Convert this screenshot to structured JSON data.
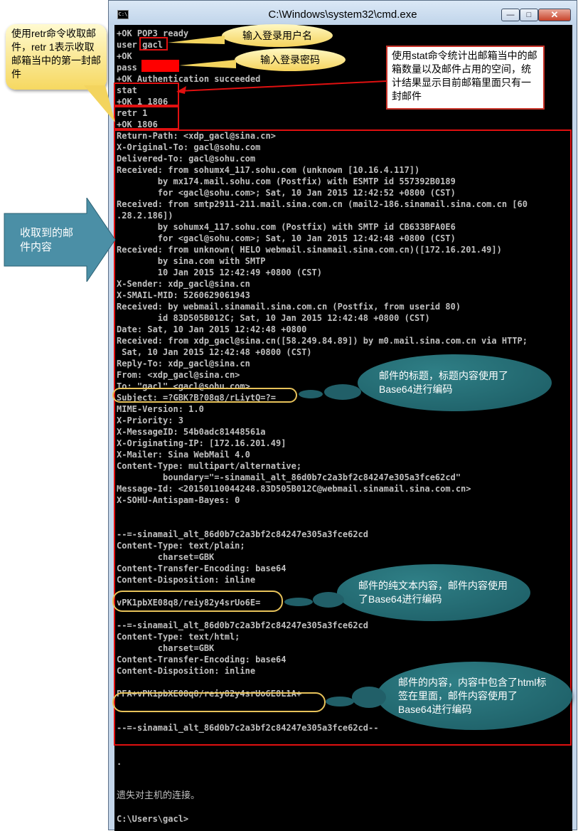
{
  "window": {
    "title": "C:\\Windows\\system32\\cmd.exe",
    "icon_text": "C:\\",
    "min": "—",
    "max": "□",
    "close": "✕"
  },
  "console_lines": [
    "+OK POP3 ready",
    "user gacl",
    "+OK",
    "pass",
    "+OK Authentication succeeded",
    "stat",
    "+OK 1 1806",
    "retr 1",
    "+OK 1806",
    "Return-Path: <xdp_gacl@sina.cn>",
    "X-Original-To: gacl@sohu.com",
    "Delivered-To: gacl@sohu.com",
    "Received: from sohumx4_117.sohu.com (unknown [10.16.4.117])",
    "        by mx174.mail.sohu.com (Postfix) with ESMTP id 557392B0189",
    "        for <gacl@sohu.com>; Sat, 10 Jan 2015 12:42:52 +0800 (CST)",
    "Received: from smtp2911-211.mail.sina.com.cn (mail2-186.sinamail.sina.com.cn [60",
    ".28.2.186])",
    "        by sohumx4_117.sohu.com (Postfix) with SMTP id CB633BFA0E6",
    "        for <gacl@sohu.com>; Sat, 10 Jan 2015 12:42:48 +0800 (CST)",
    "Received: from unknown( HELO webmail.sinamail.sina.com.cn)([172.16.201.49])",
    "        by sina.com with SMTP",
    "        10 Jan 2015 12:42:49 +0800 (CST)",
    "X-Sender: xdp_gacl@sina.cn",
    "X-SMAIL-MID: 5260629061943",
    "Received: by webmail.sinamail.sina.com.cn (Postfix, from userid 80)",
    "        id 83D505B012C; Sat, 10 Jan 2015 12:42:48 +0800 (CST)",
    "Date: Sat, 10 Jan 2015 12:42:48 +0800",
    "Received: from xdp_gacl@sina.cn([58.249.84.89]) by m0.mail.sina.com.cn via HTTP;",
    " Sat, 10 Jan 2015 12:42:48 +0800 (CST)",
    "Reply-To: xdp_gacl@sina.cn",
    "From: <xdp_gacl@sina.cn>",
    "To: \"gacl\" <gacl@sohu.com>",
    "Subject: =?GBK?B?08q8/rLiytQ=?=",
    "MIME-Version: 1.0",
    "X-Priority: 3",
    "X-MessageID: 54b0adc81448561a",
    "X-Originating-IP: [172.16.201.49]",
    "X-Mailer: Sina WebMail 4.0",
    "Content-Type: multipart/alternative;",
    "         boundary=\"=-sinamail_alt_86d0b7c2a3bf2c84247e305a3fce62cd\"",
    "Message-Id: <20150110044248.83D505B012C@webmail.sinamail.sina.com.cn>",
    "X-SOHU-Antispam-Bayes: 0",
    "",
    "",
    "--=-sinamail_alt_86d0b7c2a3bf2c84247e305a3fce62cd",
    "Content-Type: text/plain;",
    "        charset=GBK",
    "Content-Transfer-Encoding: base64",
    "Content-Disposition: inline",
    "",
    "vPK1pbXE08q8/reiy82y4srUo6E=",
    "",
    "--=-sinamail_alt_86d0b7c2a3bf2c84247e305a3fce62cd",
    "Content-Type: text/html;",
    "        charset=GBK",
    "Content-Transfer-Encoding: base64",
    "Content-Disposition: inline",
    "",
    "PFA+vPK1pbXE08q8/reiy82y4srUo6E8L1A+",
    "",
    "",
    "--=-sinamail_alt_86d0b7c2a3bf2c84247e305a3fce62cd--",
    "",
    "",
    ".",
    "",
    "",
    "遗失对主机的连接。",
    "",
    "C:\\Users\\gacl>"
  ],
  "callouts": {
    "retr_note": "使用retr命令收取邮件，retr 1表示收取邮箱当中的第一封邮件",
    "user_note": "输入登录用户名",
    "pass_note": "输入登录密码",
    "stat_note": "使用stat命令统计出邮箱当中的邮箱数量以及邮件占用的空间，统计结果显示目前邮箱里面只有一封邮件",
    "received_note": "收取到的邮件内容",
    "subject_note": "邮件的标题，标题内容使用了Base64进行编码",
    "plain_note": "邮件的纯文本内容，邮件内容使用了Base64进行编码",
    "html_note": "邮件的内容，内容中包含了html标签在里面，邮件内容使用了Base64进行编码"
  }
}
